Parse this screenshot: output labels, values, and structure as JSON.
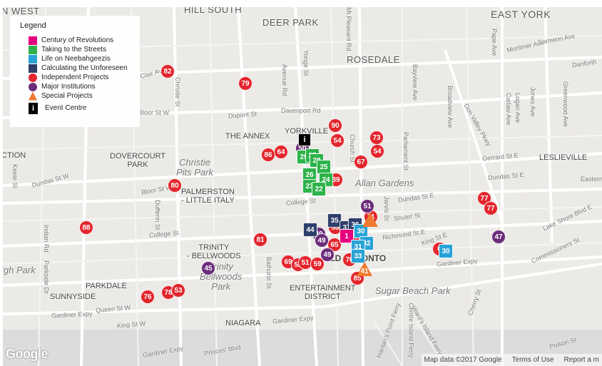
{
  "legend": {
    "title": "Legend",
    "items": [
      {
        "label": "Century of Revolutions",
        "shape": "square",
        "color": "#e6007e"
      },
      {
        "label": "Taking to the Streets",
        "shape": "square",
        "color": "#2eb34b"
      },
      {
        "label": "Life on Neebahgeezis",
        "shape": "square",
        "color": "#29a3d6"
      },
      {
        "label": "Calculating the Unforeseen",
        "shape": "square",
        "color": "#2f3f6b"
      },
      {
        "label": "Independent Projects",
        "shape": "circle",
        "color": "#e3262d"
      },
      {
        "label": "Major Institutions",
        "shape": "circle",
        "color": "#6b2d7b"
      },
      {
        "label": "Special Projects",
        "shape": "triangle",
        "color": "#f07a2e"
      },
      {
        "label": "Event Centre",
        "shape": "info",
        "color": "#000000",
        "glyph": "i"
      }
    ]
  },
  "map_labels": {
    "west": "N WEST",
    "hill_south": "HILL SOUTH",
    "deer_park": "DEER PARK",
    "east_york": "EAST YORK",
    "rosedale": "ROSEDALE",
    "the_annex": "THE ANNEX",
    "yorkville": "YORKVILLE",
    "dovercourt_park": "DOVERCOURT\nPARK",
    "christie_pits_park": "Christie\nPits Park",
    "leslieville": "LESLIEVILLE",
    "allan_gardens": "Allan Gardens",
    "palmerston": "PALMERSTON\n- LITTLE ITALY",
    "trinity_bellwoods": "TRINITY\n- BELLWOODS",
    "trinity_bellwoods_park": "Trinity\nBellwoods\nPark",
    "parkdale": "PARKDALE",
    "sunnyside": "SUNNYSIDE",
    "high_park": "igh Park",
    "entertainment_district": "ENTERTAINMENT\nDISTRICT",
    "sugar_beach_park": "Sugar Beach Park",
    "niagara": "NIAGARA",
    "old_toronto": "OLD TORONTO",
    "ction": "CTION",
    "roads": {
      "st_clair_ave": "Clair Ave W",
      "christie_st": "Christie St",
      "avenue_rd": "Avenue Rd",
      "yonge_st": "Yonge St",
      "mt_pleasant": "Mt Pleasant Rd",
      "bayview_ave": "Bayview Ave",
      "pape_ave": "Pape Ave",
      "mortimer_ave": "Mortimer Ave",
      "samwon_ave": "Samwon Ave",
      "danforth": "Danforth",
      "broadview_ave": "Broadview Ave",
      "jones_ave": "Jones Ave",
      "greenwood_ave": "Greenwood Ave",
      "carlaw_ave": "Carlaw Ave",
      "logan_ave": "Logan Ave",
      "dupont_st": "Dupont St",
      "davenport_rd": "Davenport Rd",
      "bloor_st_w": "Bloor St W",
      "bloor_st_w_2": "Bloor St W",
      "dundas_st_w": "Dundas St W",
      "dundas_st_e": "Dundas St E",
      "dundas_st_e_2": "Dundas St E",
      "gerrard_st_e": "Gerrard St E",
      "college_st": "College St",
      "college_st_2": "College St",
      "dufferin_st": "Dufferin St",
      "indian_rd": "Indian Rd",
      "parkside_dr": "Parkside Dr",
      "shuter_st": "Shuter St",
      "richmond_st_e": "Richmond St E",
      "king_st_e": "King St E",
      "queen_st_w": "Queen St W",
      "king_st_w": "King St W",
      "gardiner_expy": "Gardiner Expy",
      "gardiner_expy_2": "Gardiner Expy",
      "gardiner_expy_3": "Gardiner Expy",
      "gardiner_expy_4": "Gardiner Expy",
      "bathurst_st": "Bathurst St",
      "princes_blvd": "Princes' Blvd",
      "lake_shore": "Lake Shore Blvd E",
      "commissioners_st": "Commissioners St",
      "don_valley_pkwy": "Don Valley Pkwy",
      "parliament_st": "Parliament St",
      "jarvis_st": "Jarvis St",
      "church_st": "Church St",
      "keele_st": "Keele St",
      "eastern": "Eastern",
      "polson_st": "Polson St",
      "cherry_st": "Cherry St",
      "wards_island_ferry": "Ward's Island Ferry",
      "hanlans_ferry": "Hanlan's Point Ferry",
      "centre_island_ferry": "Centre Island Ferry"
    }
  },
  "markers": [
    {
      "label": "82",
      "cat": "independent",
      "lon": 231,
      "lat": 90
    },
    {
      "label": "79",
      "cat": "independent",
      "lon": 340,
      "lat": 107
    },
    {
      "label": "90",
      "cat": "independent",
      "lon": 466,
      "lat": 166
    },
    {
      "label": "54",
      "cat": "independent",
      "lon": 469,
      "lat": 187
    },
    {
      "label": "73",
      "cat": "independent",
      "lon": 524,
      "lat": 183
    },
    {
      "label": "54",
      "cat": "independent",
      "lon": 525,
      "lat": 202
    },
    {
      "label": "86",
      "cat": "independent",
      "lon": 372,
      "lat": 207
    },
    {
      "label": "64",
      "cat": "independent",
      "lon": 390,
      "lat": 203
    },
    {
      "label": "67",
      "cat": "independent",
      "lon": 502,
      "lat": 217
    },
    {
      "label": "39",
      "cat": "independent",
      "lon": 467,
      "lat": 242
    },
    {
      "label": "80",
      "cat": "independent",
      "lon": 241,
      "lat": 250
    },
    {
      "label": "77",
      "cat": "independent",
      "lon": 675,
      "lat": 268
    },
    {
      "label": "77",
      "cat": "independent",
      "lon": 684,
      "lat": 282
    },
    {
      "label": "88",
      "cat": "independent",
      "lon": 117,
      "lat": 309
    },
    {
      "label": "81",
      "cat": "independent",
      "lon": 361,
      "lat": 326
    },
    {
      "label": "6",
      "cat": "independent",
      "lon": 612,
      "lat": 339
    },
    {
      "label": "69",
      "cat": "independent",
      "lon": 400,
      "lat": 357
    },
    {
      "label": "52",
      "cat": "independent",
      "lon": 414,
      "lat": 361
    },
    {
      "label": "51",
      "cat": "independent",
      "lon": 424,
      "lat": 358
    },
    {
      "label": "59",
      "cat": "independent",
      "lon": 441,
      "lat": 360
    },
    {
      "label": "70",
      "cat": "independent",
      "lon": 486,
      "lat": 354
    },
    {
      "label": "85",
      "cat": "independent",
      "lon": 497,
      "lat": 380
    },
    {
      "label": "76",
      "cat": "independent",
      "lon": 203,
      "lat": 406
    },
    {
      "label": "78",
      "cat": "independent",
      "lon": 232,
      "lat": 400
    },
    {
      "label": "53",
      "cat": "independent",
      "lon": 246,
      "lat": 397
    },
    {
      "label": "53",
      "cat": "independent",
      "lon": 466,
      "lat": 309
    },
    {
      "label": "65",
      "cat": "independent",
      "lon": 465,
      "lat": 333
    },
    {
      "label": "71",
      "cat": "independent",
      "lon": 516,
      "lat": 294
    },
    {
      "label": "74",
      "cat": "independent",
      "lon": 491,
      "lat": 322
    },
    {
      "label": "51",
      "cat": "major",
      "lon": 511,
      "lat": 279
    },
    {
      "label": "47",
      "cat": "major",
      "lon": 695,
      "lat": 322
    },
    {
      "label": "49",
      "cat": "major",
      "lon": 443,
      "lat": 318
    },
    {
      "label": "49",
      "cat": "major",
      "lon": 447,
      "lat": 327
    },
    {
      "label": "49",
      "cat": "major",
      "lon": 455,
      "lat": 347
    },
    {
      "label": "45",
      "cat": "major",
      "lon": 288,
      "lat": 366
    },
    {
      "label": "50",
      "cat": "major",
      "lon": 420,
      "lat": 198
    },
    {
      "label": "29",
      "cat": "streets",
      "lon": 422,
      "lat": 210
    },
    {
      "label": "27",
      "cat": "streets",
      "lon": 434,
      "lat": 208
    },
    {
      "label": "28",
      "cat": "streets",
      "lon": 440,
      "lat": 215
    },
    {
      "label": "25",
      "cat": "streets",
      "lon": 450,
      "lat": 224
    },
    {
      "label": "26",
      "cat": "streets",
      "lon": 430,
      "lat": 235
    },
    {
      "label": "24",
      "cat": "streets",
      "lon": 453,
      "lat": 242
    },
    {
      "label": "23",
      "cat": "streets",
      "lon": 430,
      "lat": 251
    },
    {
      "label": "22",
      "cat": "streets",
      "lon": 443,
      "lat": 255
    },
    {
      "label": "35",
      "cat": "unforeseen",
      "lon": 465,
      "lat": 299
    },
    {
      "label": "37",
      "cat": "unforeseen",
      "lon": 482,
      "lat": 309
    },
    {
      "label": "36",
      "cat": "unforeseen",
      "lon": 494,
      "lat": 305
    },
    {
      "label": "44",
      "cat": "unforeseen",
      "lon": 431,
      "lat": 312
    },
    {
      "label": "1",
      "cat": "revolutions",
      "lon": 482,
      "lat": 321
    },
    {
      "label": "30",
      "cat": "neebahgeezis",
      "lon": 502,
      "lat": 314
    },
    {
      "label": "32",
      "cat": "neebahgeezis",
      "lon": 510,
      "lat": 331
    },
    {
      "label": "31",
      "cat": "neebahgeezis",
      "lon": 498,
      "lat": 336
    },
    {
      "label": "33",
      "cat": "neebahgeezis",
      "lon": 498,
      "lat": 349
    },
    {
      "label": "30",
      "cat": "neebahgeezis",
      "lon": 621,
      "lat": 342
    },
    {
      "label": "41",
      "cat": "special",
      "lon": 507,
      "lat": 369
    },
    {
      "label": "",
      "cat": "special",
      "lon": 515,
      "lat": 300
    },
    {
      "label": "i",
      "cat": "event",
      "lon": 423,
      "lat": 186
    }
  ],
  "categories": {
    "revolutions": {
      "shape": "square",
      "color": "#e6007e"
    },
    "streets": {
      "shape": "square",
      "color": "#2eb34b"
    },
    "neebahgeezis": {
      "shape": "square",
      "color": "#29a3d6"
    },
    "unforeseen": {
      "shape": "square",
      "color": "#2f3f6b"
    },
    "independent": {
      "shape": "circle",
      "color": "#e3262d"
    },
    "major": {
      "shape": "circle",
      "color": "#6b2d7b"
    },
    "special": {
      "shape": "triangle",
      "color": "#f07a2e"
    },
    "event": {
      "shape": "info",
      "color": "#000000"
    }
  },
  "branding": {
    "logo": "Google"
  },
  "attribution": {
    "map_data": "Map data ©2017 Google",
    "terms": "Terms of Use",
    "report": "Report a m"
  }
}
